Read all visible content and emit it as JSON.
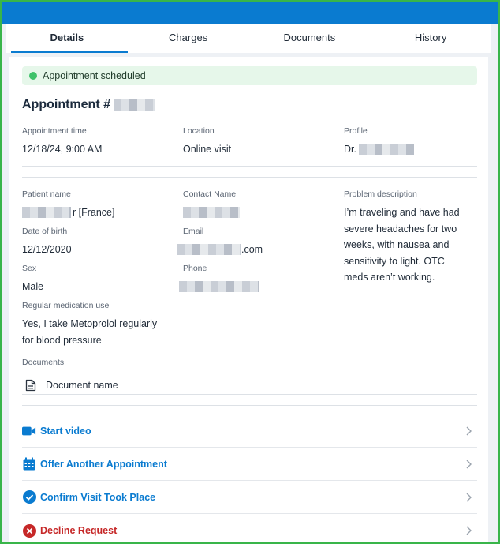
{
  "tabs": [
    {
      "label": "Details",
      "active": true
    },
    {
      "label": "Charges",
      "active": false
    },
    {
      "label": "Documents",
      "active": false
    },
    {
      "label": "History",
      "active": false
    }
  ],
  "status": {
    "text": "Appointment scheduled",
    "color": "#3ec26a"
  },
  "appointment": {
    "title": "Appointment #"
  },
  "info": {
    "time_label": "Appointment time",
    "time_value": "12/18/24, 9:00 AM",
    "location_label": "Location",
    "location_value": "Online visit",
    "profile_label": "Profile",
    "profile_value": "Dr."
  },
  "patient": {
    "name_label": "Patient name",
    "name_value": "r [France]",
    "dob_label": "Date of birth",
    "dob_value": "12/12/2020",
    "sex_label": "Sex",
    "sex_value": "Male",
    "medication_label": "Regular medication use",
    "medication_value": "Yes, I take Metoprolol regularly for blood pressure",
    "contact_label": "Contact Name",
    "email_label": "Email",
    "email_value": ".com",
    "phone_label": "Phone",
    "problem_label": "Problem description",
    "problem_value": "I’m traveling and have had severe headaches for two weeks, with nausea and sensitivity to light. OTC meds aren’t working."
  },
  "documents": {
    "label": "Documents",
    "items": [
      "Document name"
    ]
  },
  "actions": [
    {
      "label": "Start video",
      "icon": "video-camera-icon",
      "color": "#0a7bd0"
    },
    {
      "label": "Offer Another Appointment",
      "icon": "calendar-icon",
      "color": "#0a7bd0"
    },
    {
      "label": "Confirm Visit Took Place",
      "icon": "check-circle-icon",
      "color": "#0a7bd0"
    },
    {
      "label": "Decline Request",
      "icon": "x-circle-icon",
      "color": "#c62828"
    }
  ],
  "colors": {
    "brand": "#0a7bd0",
    "border": "#39b54a",
    "danger": "#c62828"
  }
}
